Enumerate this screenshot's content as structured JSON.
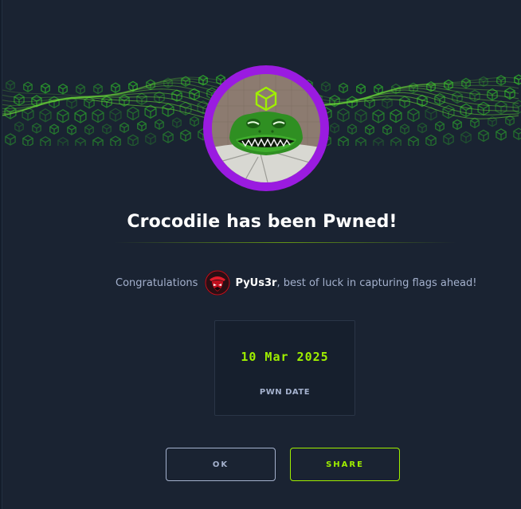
{
  "modal": {
    "title": "Crocodile has been Pwned!",
    "congrats_prefix": "Congratulations",
    "username": "PyUs3r",
    "congrats_suffix": ", best of luck in capturing flags ahead!",
    "pwn_date": "10 Mar 2025",
    "pwn_date_label": "PWN DATE",
    "ok_label": "OK",
    "share_label": "SHARE"
  },
  "colors": {
    "background": "#141d2b",
    "panel": "#1a2332",
    "accent_green": "#9fef00",
    "avatar_ring": "#9a1be0",
    "muted_text": "#a4b1cd"
  },
  "icons": {
    "machine_avatar": "crocodile-avatar-icon",
    "user_avatar": "hacker-avatar-icon",
    "banner": "green-hexagon-wave-banner"
  }
}
